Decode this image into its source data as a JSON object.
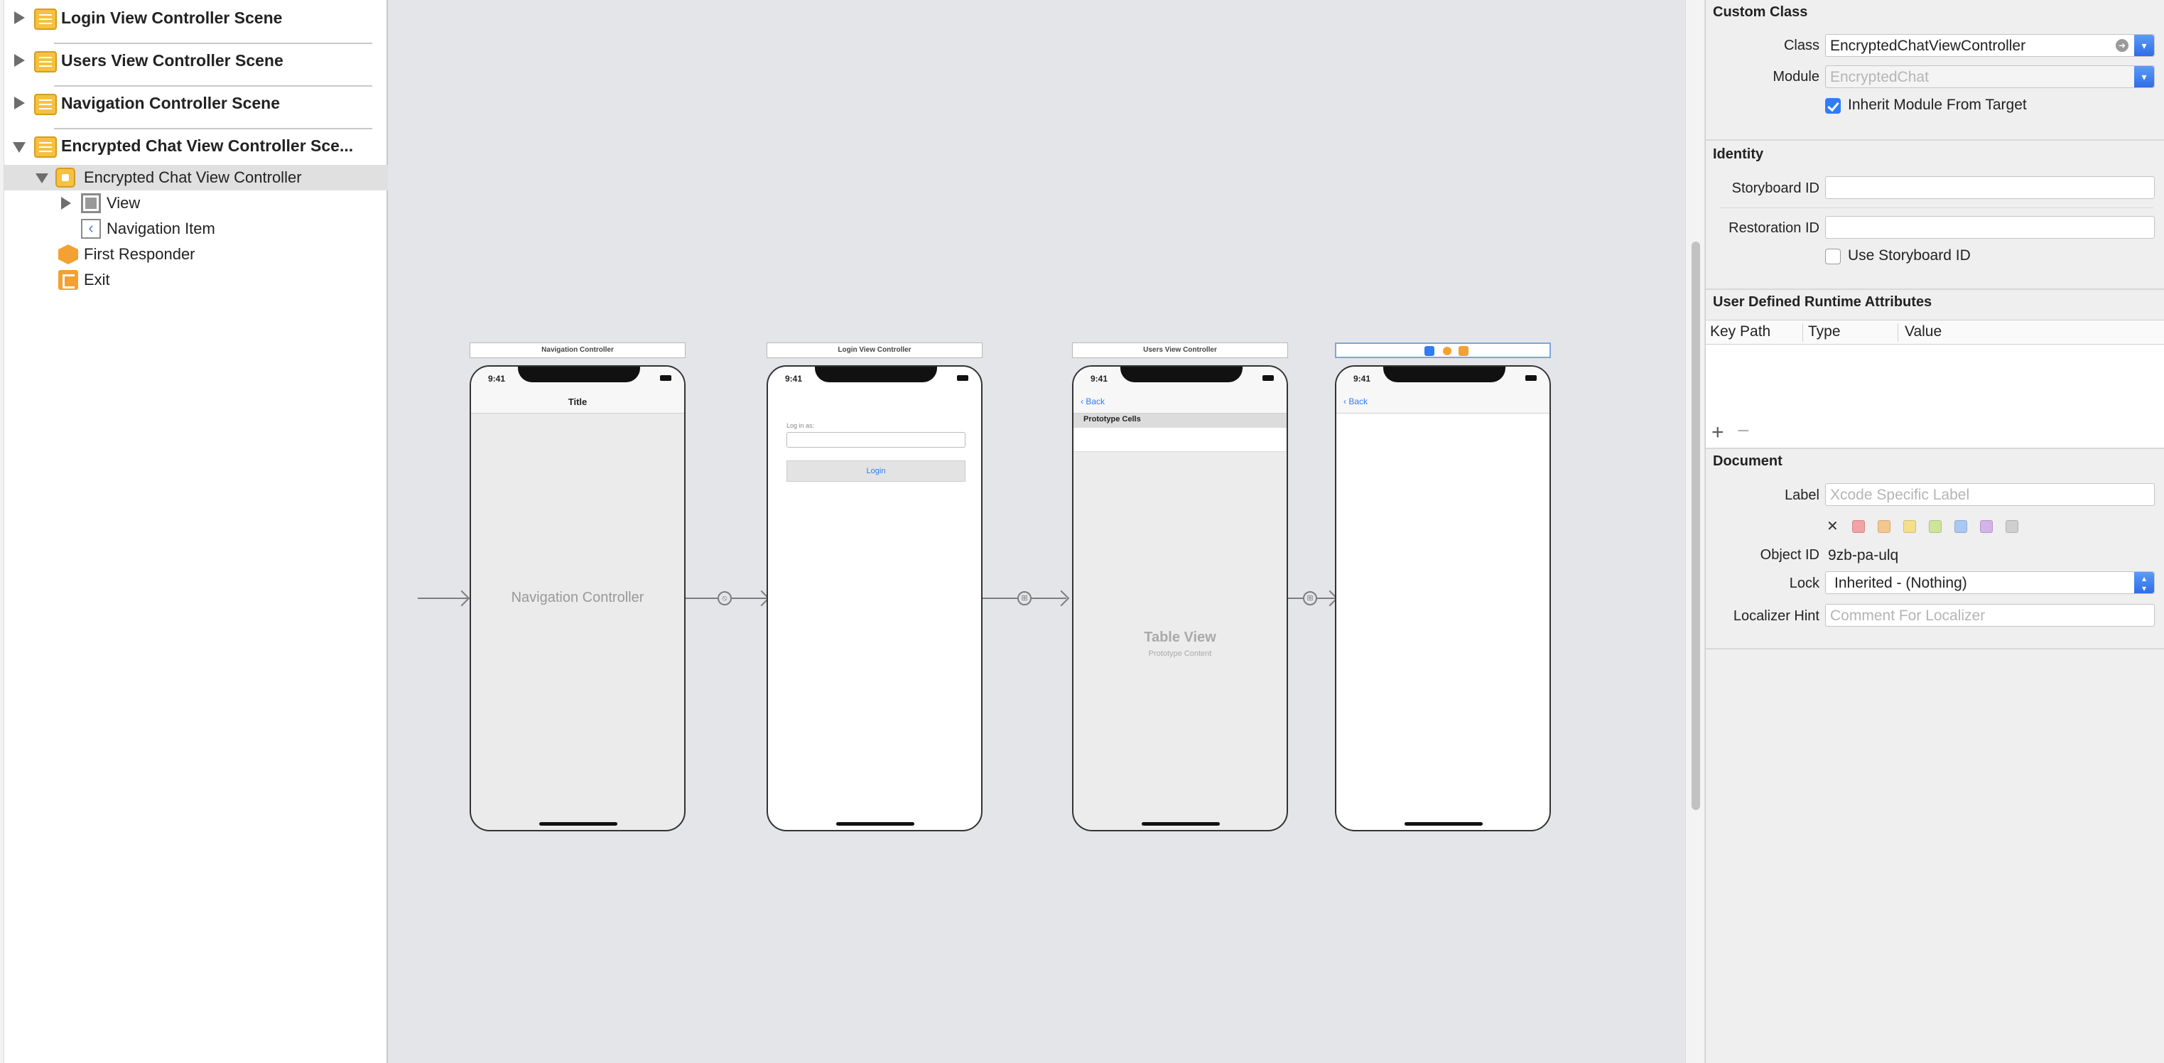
{
  "outline": {
    "scenes": [
      {
        "label": "Login View Controller Scene",
        "expanded": false
      },
      {
        "label": "Users View Controller Scene",
        "expanded": false
      },
      {
        "label": "Navigation Controller Scene",
        "expanded": false
      },
      {
        "label": "Encrypted Chat View Controller Sce...",
        "expanded": true
      }
    ],
    "tree": {
      "vc": "Encrypted Chat View Controller",
      "view": "View",
      "nav_item": "Navigation Item",
      "first_responder": "First Responder",
      "exit": "Exit"
    }
  },
  "canvas": {
    "scenes": [
      {
        "title": "Navigation Controller",
        "time": "9:41",
        "nav_title": "Title",
        "body": "Navigation Controller"
      },
      {
        "title": "Login View Controller",
        "time": "9:41",
        "field_label": "Log in as:",
        "button": "Login"
      },
      {
        "title": "Users View Controller",
        "time": "9:41",
        "back": "Back",
        "section": "Prototype Cells",
        "table_title": "Table View",
        "table_sub": "Prototype Content"
      },
      {
        "title": "",
        "time": "9:41",
        "back": "Back"
      }
    ]
  },
  "inspector": {
    "custom_class": {
      "heading": "Custom Class",
      "class_label": "Class",
      "class_value": "EncryptedChatViewController",
      "module_label": "Module",
      "module_placeholder": "EncryptedChat",
      "inherit_label": "Inherit Module From Target",
      "inherit_checked": true
    },
    "identity": {
      "heading": "Identity",
      "storyboard_label": "Storyboard ID",
      "storyboard_value": "",
      "restoration_label": "Restoration ID",
      "restoration_value": "",
      "use_storyboard_label": "Use Storyboard ID",
      "use_storyboard_checked": false
    },
    "udra": {
      "heading": "User Defined Runtime Attributes",
      "columns": [
        "Key Path",
        "Type",
        "Value"
      ],
      "add": "+",
      "remove": "−"
    },
    "document": {
      "heading": "Document",
      "label_label": "Label",
      "label_placeholder": "Xcode Specific Label",
      "clear_glyph": "✕",
      "swatch_colors": [
        "#f2a3a3",
        "#f3c88f",
        "#f4e08a",
        "#cde59a",
        "#a9c8f3",
        "#d3b3e8",
        "#cfcfcf"
      ],
      "object_id_label": "Object ID",
      "object_id_value": "9zb-pa-ulq",
      "lock_label": "Lock",
      "lock_value": "Inherited - (Nothing)",
      "localizer_label": "Localizer Hint",
      "localizer_placeholder": "Comment For Localizer"
    }
  }
}
